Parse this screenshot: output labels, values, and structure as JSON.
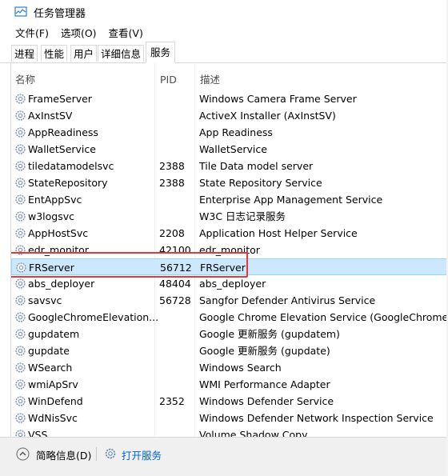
{
  "window": {
    "title": "任务管理器"
  },
  "menu": [
    "文件(F)",
    "选项(O)",
    "查看(V)"
  ],
  "tabs": [
    "进程",
    "性能",
    "用户",
    "详细信息",
    "服务"
  ],
  "active_tab": "服务",
  "columns": {
    "name": "名称",
    "pid": "PID",
    "desc": "描述"
  },
  "rows": [
    {
      "name": "FrameServer",
      "pid": "",
      "desc": "Windows Camera Frame Server"
    },
    {
      "name": "AxInstSV",
      "pid": "",
      "desc": "ActiveX Installer (AxInstSV)"
    },
    {
      "name": "AppReadiness",
      "pid": "",
      "desc": "App Readiness"
    },
    {
      "name": "WalletService",
      "pid": "",
      "desc": "WalletService"
    },
    {
      "name": "tiledatamodelsvc",
      "pid": "2388",
      "desc": "Tile Data model server"
    },
    {
      "name": "StateRepository",
      "pid": "2388",
      "desc": "State Repository Service"
    },
    {
      "name": "EntAppSvc",
      "pid": "",
      "desc": "Enterprise App Management Service"
    },
    {
      "name": "w3logsvc",
      "pid": "",
      "desc": "W3C 日志记录服务"
    },
    {
      "name": "AppHostSvc",
      "pid": "2208",
      "desc": "Application Host Helper Service"
    },
    {
      "name": "edr_monitor",
      "pid": "42100",
      "desc": "edr_monitor"
    },
    {
      "name": "FRServer",
      "pid": "56712",
      "desc": "FRServer"
    },
    {
      "name": "abs_deployer",
      "pid": "48404",
      "desc": "abs_deployer"
    },
    {
      "name": "savsvc",
      "pid": "56728",
      "desc": "Sangfor Defender Antivirus Service"
    },
    {
      "name": "GoogleChromeElevation...",
      "pid": "",
      "desc": "Google Chrome Elevation Service (GoogleChromeElev"
    },
    {
      "name": "gupdatem",
      "pid": "",
      "desc": "Google 更新服务 (gupdatem)"
    },
    {
      "name": "gupdate",
      "pid": "",
      "desc": "Google 更新服务 (gupdate)"
    },
    {
      "name": "WSearch",
      "pid": "",
      "desc": "Windows Search"
    },
    {
      "name": "wmiApSrv",
      "pid": "",
      "desc": "WMI Performance Adapter"
    },
    {
      "name": "WinDefend",
      "pid": "2352",
      "desc": "Windows Defender Service"
    },
    {
      "name": "WdNisSvc",
      "pid": "",
      "desc": "Windows Defender Network Inspection Service"
    },
    {
      "name": "VSS",
      "pid": "",
      "desc": "Volume Shadow Copy"
    }
  ],
  "selected_row": "FRServer",
  "footer": {
    "fewer_details": "简略信息(D)",
    "open_services": "打开服务"
  },
  "colors": {
    "selection": "#cce8ff",
    "highlight_box": "#e53935",
    "link": "#0066cc"
  }
}
